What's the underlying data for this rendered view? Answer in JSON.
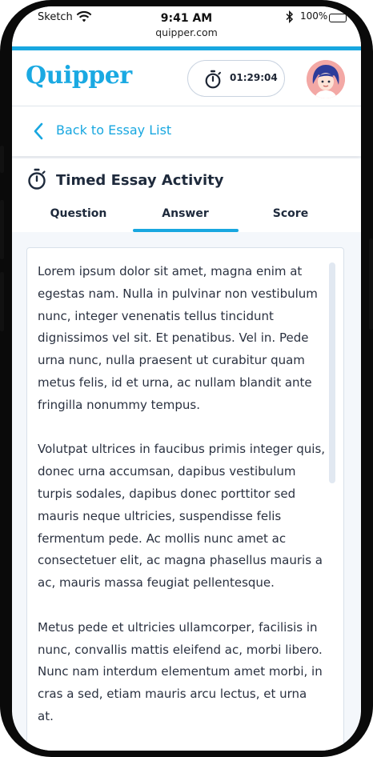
{
  "status_bar": {
    "carrier": "Sketch",
    "time": "9:41 AM",
    "url": "quipper.com",
    "battery": "100%"
  },
  "header": {
    "logo": "Quipper",
    "timer": "01:29:04"
  },
  "nav": {
    "back_label": "Back to Essay List"
  },
  "activity": {
    "title": "Timed Essay Activity",
    "tabs": [
      {
        "label": "Question",
        "active": false
      },
      {
        "label": "Answer",
        "active": true
      },
      {
        "label": "Score",
        "active": false
      }
    ]
  },
  "essay": {
    "paragraphs": [
      "Lorem ipsum dolor sit amet, magna enim at egestas nam. Nulla in pulvinar non vestibulum nunc, integer venenatis tellus tincidunt dignissimos vel sit. Et penatibus. Vel in. Pede urna nunc, nulla praesent ut curabitur quam metus felis, id et urna, ac nullam blandit ante fringilla nonummy tempus.",
      "Volutpat ultrices in faucibus primis integer quis, donec urna accumsan, dapibus vestibulum turpis sodales, dapibus donec porttitor sed mauris neque ultricies, suspendisse felis fermentum pede. Ac mollis nunc amet ac consectetuer elit, ac magna phasellus mauris a ac, mauris massa feugiat pellentesque.",
      "Metus pede et ultricies ullamcorper, facilisis in nunc, convallis mattis eleifend ac, morbi libero. Nunc nam interdum elementum amet morbi, in cras a sed, etiam mauris arcu lectus, et urna at."
    ]
  },
  "colors": {
    "accent": "#18a7e0",
    "text_dark": "#1e2a3c",
    "background": "#f4f7fb"
  },
  "icons": [
    "wifi-icon",
    "bluetooth-icon",
    "battery-icon",
    "stopwatch-icon",
    "chevron-left-icon",
    "avatar"
  ]
}
